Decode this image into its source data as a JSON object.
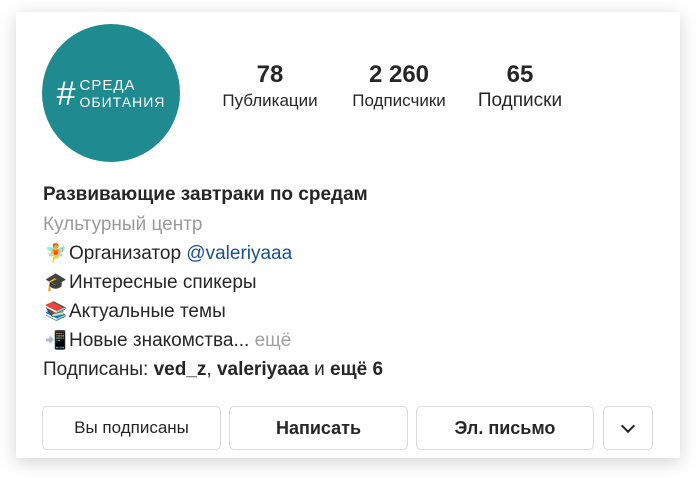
{
  "profile": {
    "avatar": {
      "hash": "#",
      "line1": "СРЕДА",
      "line2": "ОБИТАНИЯ",
      "color": "#1f8a8f"
    },
    "stats": {
      "publications": {
        "value": "78",
        "label": "Публикации"
      },
      "followers": {
        "value": "2 260",
        "label": "Подписчики"
      },
      "following": {
        "value": "65",
        "label": "Подписки"
      }
    },
    "bio": {
      "name": "Развивающие завтраки по средам",
      "category": "Культурный центр",
      "lines": [
        {
          "icon": "fairy-icon",
          "emoji": "🧚",
          "text": "Организатор ",
          "mention": "@valeriyaaa"
        },
        {
          "icon": "graduate-icon",
          "emoji": "🎓",
          "text": "Интересные спикеры"
        },
        {
          "icon": "books-icon",
          "emoji": "📚",
          "text": "Актуальные темы"
        },
        {
          "icon": "phone-arrow-icon",
          "emoji": "📲",
          "text": "Новые знакомства...",
          "more": " ещё"
        }
      ],
      "followed_by": {
        "prefix": "Подписаны: ",
        "user1": "ved_z",
        "sep": ", ",
        "user2": "valeriyaaa",
        "and": " и ",
        "rest": "ещё 6"
      }
    },
    "buttons": {
      "subscribed": "Вы подписаны",
      "message": "Написать",
      "email": "Эл. письмо",
      "dropdown_icon": "chevron-down-icon"
    },
    "colors": {
      "mention": "#1d4f8c",
      "muted": "#9a9a9a",
      "text": "#262626"
    }
  }
}
